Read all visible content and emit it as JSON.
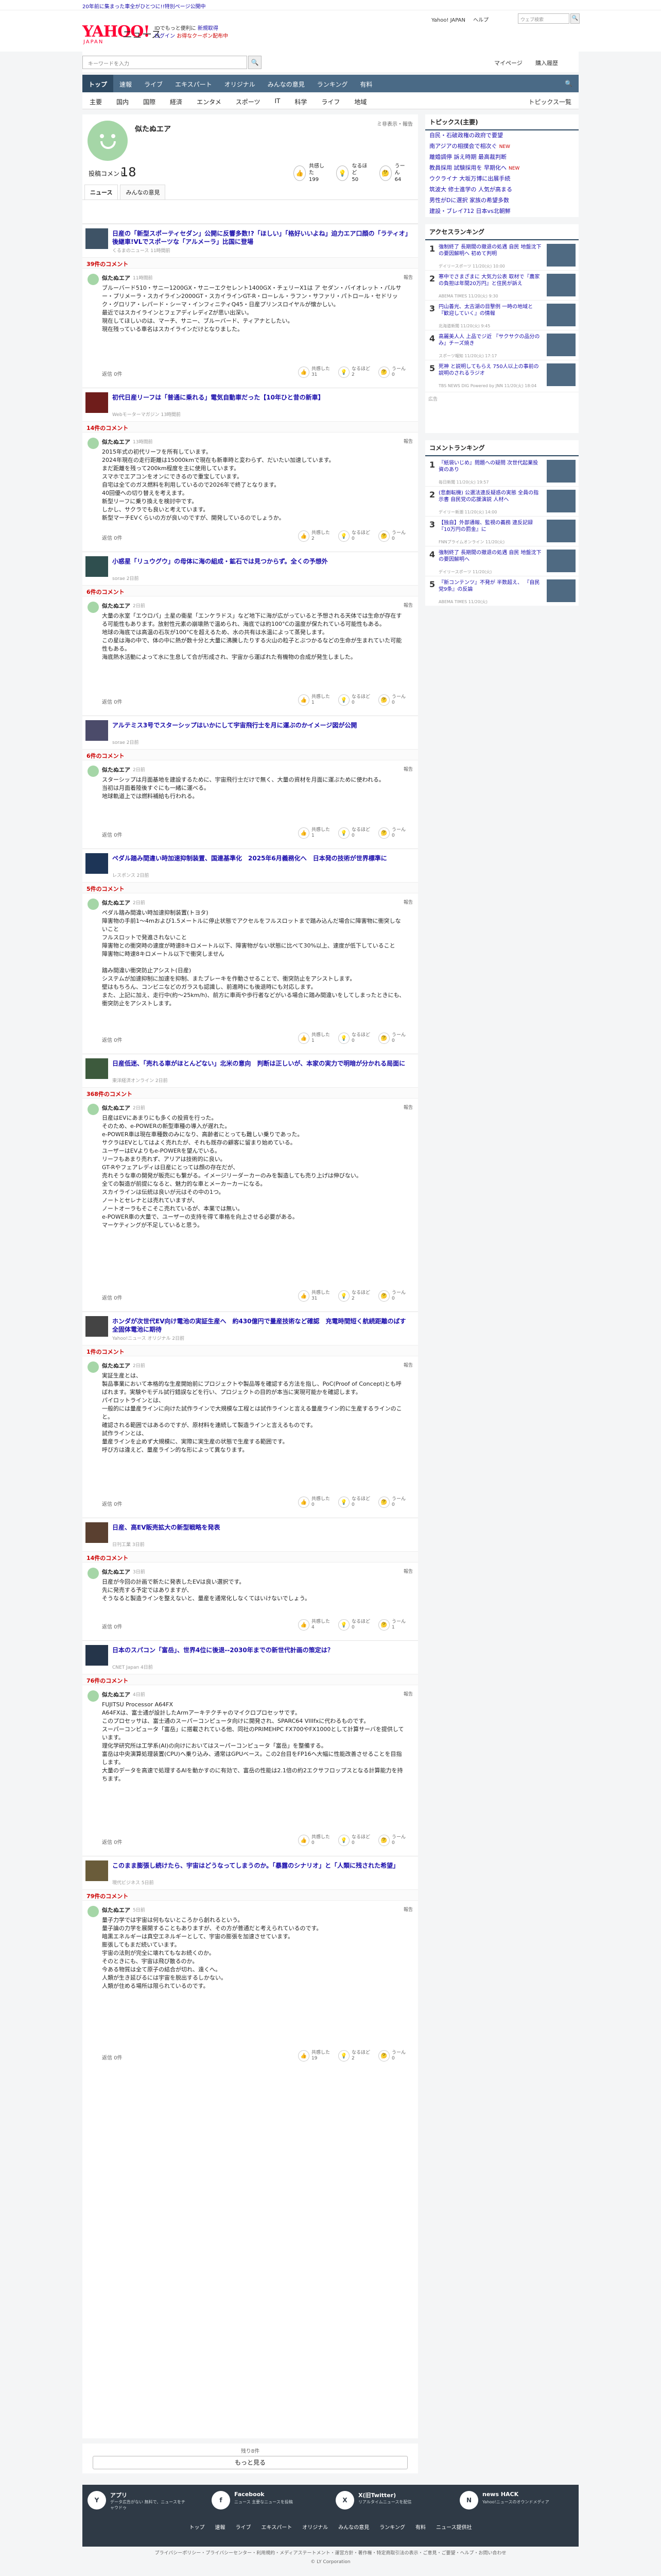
{
  "topnote": "20年前に集まった車全がひとつに!!特別ページ公開中",
  "header": {
    "logo": "YAHOO!",
    "logo_sub": "JAPAN",
    "service": "ニュース",
    "promo_line1": "IDでもっと便利に",
    "promo_link": "新規取得",
    "promo_line2": "ログイン",
    "promo_red": "お得なクーポン配布中",
    "right_links": [
      "Yahoo! JAPAN",
      "ヘルプ"
    ],
    "search_placeholder": "ウェブ検索",
    "search_btn": "🔍"
  },
  "searchrow": {
    "placeholder": "キーワードを入力",
    "mypage": "マイページ",
    "purchase": "購入履歴"
  },
  "gnav": {
    "items": [
      "トップ",
      "速報",
      "ライブ",
      "エキスパート",
      "オリジナル",
      "みんなの意見",
      "ランキング",
      "有料"
    ],
    "active": 0,
    "right": "🔍"
  },
  "subnav": {
    "items": [
      "主要",
      "国内",
      "国際",
      "経済",
      "エンタメ",
      "スポーツ",
      "IT",
      "科学",
      "ライフ",
      "地域"
    ],
    "right": "トピックス一覧"
  },
  "profile": {
    "name": "似たぬエア",
    "flag": "ミ非表示・報告",
    "comments_label": "投稿コメント",
    "comments": "18",
    "stats": [
      {
        "icon": "👍",
        "label": "共感した",
        "value": "199"
      },
      {
        "icon": "💡",
        "label": "なるほど",
        "value": "50"
      },
      {
        "icon": "🤔",
        "label": "うーん",
        "value": "64"
      }
    ],
    "tabs": [
      "ニュース",
      "みんなの意見"
    ]
  },
  "articles": [
    {
      "title": "日産の「新型スポーティセダン」公開に反響多数!?「ほしい」「格好いいよね」迫力エア口顔の「ラティオ」後継車!VLでスポーツな「アルメーラ」比国に登場",
      "source": "くるまのニュース 11時間前",
      "count": "39件のコメント",
      "time": "11時間前",
      "body": "ブルーバード510・サニー1200GX・サニーエクセレント1400GX・チェリーX1は ア セダン・バイオレット・パルサー・プリメーラ・スカイライン2000GT・スカイラインGT-R・ローレル・ラフン・サファリ・パトロール・セドリック・グロリア・レパード・シーマ・インフィニティQ45・日産プリンスロイヤルが懐かしい。\n最近ではスカイラインとフェアディレディZが思い出深い。\n現在してほしいのは、マーチ、サニー、ブルーバード、ティアナとしたい。\n現在残っている車名はスカイラインだけとなりました。",
      "reactions": [
        "31",
        "2",
        "0"
      ]
    },
    {
      "title": "初代日産リーフは「普通に乗れる」電気自動車だった【10年ひと昔の新車】",
      "source": "Webモーターマガジン 13時間前",
      "count": "14件のコメント",
      "time": "13時間前",
      "body": "2015年式の初代リーフを所有しています。\n2024年現在の走行距離は15000kmで現在も新車時と変わらず、だいたい加速しています。\nまだ距離を残って200km程度を主に使用しています。\nスマホでエアコンをオンにできるので重宝しています。\n自宅は全てのガス燃料を利用しているので2026年で終了となります。\n40回優への切り替えを考えます。\n新型リーフに乗り換えを検討中です。\nしかし、サクラでも良いと考えています。\n新型マーチEVくらいの方が良いのですが、開発しているのでしょうか。",
      "reactions": [
        "2",
        "0",
        "0"
      ]
    },
    {
      "title": "小惑星「リュウグウ」の母体に海の組成・鉱石では見つからず。全くの予想外",
      "source": "sorae 2日前",
      "count": "6件のコメント",
      "time": "2日前",
      "body": "大量の氷室「エウロパ」土星の衛星「エンケラドス」など地下に海が広がっていると予想される天体では生命が存在する可能性もあります。放射性元素の崩壊熱で温められ、海底では約100°Cの温度が保たれている可能性もある。\n地球の海底では高温の石灰が100°Cを超えるため、水の共有は水温によって蒸発します。\nこの星は海の中で、体の中に熱が数十分と大量に沸騰したりする火山の粒子とぶつかるなどの生命が生まれていた可能性もある。\n海底熱水活動によって水に生息して合が形成され、宇宙から運ばれた有機物の合成が発生しました。",
      "reactions": [
        "1",
        "0",
        "0"
      ]
    },
    {
      "title": "アルテミス3号でスターシップはいかにして宇宙飛行士を月に運ぶのかイメージ図が公開",
      "source": "sorae 2日前",
      "count": "6件のコメント",
      "time": "2日前",
      "body": "スターシップは月面基地を建設するために、宇宙飛行士だけで無く、大量の資材を月面に運ぶために使われる。\n当初は月面着陸後すぐにも一緒に運べる。\n地球軌道上では燃料補給も行われる。",
      "reactions": [
        "1",
        "0",
        "0"
      ]
    },
    {
      "title": "ペダル踏み間違い時加速抑制装置、国連基準化　2025年6月義務化へ　日本発の技術が世界標準に",
      "source": "レスポンス 2日前",
      "count": "5件のコメント",
      "time": "2日前",
      "body": "ペダル踏み間違い時加速抑制装置(トヨタ)\n障害物の手前1～4mおよび1.5メートルに停止状態でアクセルをフルスロットまで踏み込んだ場合に障害物に衝突しないこと\nフルスロットで発進されないこと\n障害物との衝突時の速度が時速8キロメートル以下、障害物がない状態に比べて30%以上、速度が低下していること\n障害物に時速8キロメートル以下で衝突しません\n\n踏み間違い衝突防止アシスト(日産)\nシステムが加速抑制に加速を抑制、またブレーキを作動させることで、衝突防止をアシストします。\n壁はもちろん、コンビニなどのガラスも認識し、前進時にも後退時にも対応します。\nまた、上記に加え、走行中(約～25km/h)、前方に車両や歩行者などがいる場合に踏み間違いをしてしまったときにも、衝突防止をアシストします。",
      "reactions": [
        "1",
        "0",
        "0"
      ]
    },
    {
      "title": "日産低迷、「売れる車がほとんどない」北米の意向　判断は正しいが、本家の実力で明暗が分かれる局面に",
      "source": "東洋経済オンライン 2日前",
      "count": "368件のコメント",
      "time": "2日前",
      "body": "日産はEVにあまりにも多くの投資を行った。\nそのため、e-POWERの新型車種の導入が遅れた。\ne-POWER車は現在車種数のみになり、高齢者にとっても難しい乗りであった。\nサクラはEVとしてはよく売れたが、それも既存の顧客に留まり始めている。\nユーザーはEVよりもe-POWERを望んでいる。\nリーフもあまり売れず、アリアは技術的に良い。\nGT-Rやフェアレディは日産にとっては顔の存在だが、\n売れそうな車の開発が販売にも繋がる。イメージリーダーカーのみを製造しても売り上げは伸びない。\n全ての製造が前提になると、魅力的な車とメーカーカーになる。\nスカイラインは伝統は良いが元はその中の1つ。\nノートとセレナとは売れていますが、\nノートオーラもそこそこ売れているが、本業では無い。\ne-POWER車の大量で、ユーザーの支持を得て車格を向上させる必要がある。\nマーケティングが不足していると思う。",
      "reactions": [
        "31",
        "2",
        "0"
      ]
    },
    {
      "title": "ホンダが次世代EV向け電池の実証生産へ　約430億円で量産技術など確認　充電時間短く航続距離のばす全固体電池に期待",
      "source": "Yahoo!ニュース オリジナル 2日前",
      "count": "1件のコメント",
      "time": "2日前",
      "body": "実証生産とは、\n製品事業において本格的な生産開始前にプロジェクトや製品等を確認する方法を指し、PoC(Proof of Concept)とも呼ばれます。実験やモデル試行錯誤などを行い、プロジェクトの目的が本当に実現可能かを確認します。\nパイロットラインとは、\n一般的には量産ラインに向けた試作ラインで大規模な工程とは試作ラインと言える量産ライン的に生産するラインのこと。\n確認される範囲ではあるのですが、原材料を連続して製造ラインと言えるものです。\n試作ラインとは、\n量産ラインを止めず大規模に、実際に実生産の状態で生産する範囲です。\n呼び方は違えど、量産ライン的な形によって異なります。",
      "reactions": [
        "0",
        "0",
        "0"
      ]
    },
    {
      "title": "日産、高EV販売拡大の新型戦略を発表",
      "source": "日刊工業 3日前",
      "count": "14件のコメント",
      "time": "3日前",
      "body": "日産が今回の計画で新たに発表したEVは良い選択です。\n先に発売する予定ではありますが、\nそうなると製造ラインを整えないと、量産を通常化しなくてはいけないでしょう。",
      "reactions": [
        "4",
        "0",
        "1"
      ]
    },
    {
      "title": "日本のスパコン「富岳」、世界4位に後退--2030年までの新世代計画の策定は？",
      "source": "CNET Japan 4日前",
      "count": "76件のコメント",
      "time": "4日前",
      "body": "FUJITSU Processor A64FX\nA64FXは、富士通が設計したArmアーキテクチャのマイクロプロセッサです。\nこのプロセッサは、富士通のスーパーコンピュータ向けに開発され、SPARC64 VIIIfxに代わるものです。\nスーパーコンピュータ「富岳」に搭載されている他、同社のPRIMEHPC FX700やFX1000として計算サーバを提供しています。\n理化学研究所は工学系(AI)の向けにおいてはスーパーコンピュータ「富岳」を整備する。\n富岳は中央演算処理装置(CPU)へ乗り込み、通常はGPUベース。この2台目をFP16へ大幅に性能改善させることを目指します。\n大量のデータを高速で処理するAIを動かすのに有効で、富岳の性能は2.1倍の約2エクサフロップスとなる計算能力を持ちます。",
      "reactions": [
        "0",
        "0",
        "0"
      ]
    },
    {
      "title": "このまま膨張し続けたら、宇宙はどうなってしまうのか。「暴露のシナリオ」と「人類に残された希望」",
      "source": "現代ビジネス 5日前",
      "count": "79件のコメント",
      "time": "5日前",
      "body": "量子力学では宇宙は何もないところから創れるという。\n量子論の力学を展開することもありますが、その方が普通だと考えられているのです。\n暗黒エネルギーは真空エネルギーとして、宇宙の膨張を加速させています。\n膨張してもまだ続いています。\n宇宙の法則が完全に壊れてもなお続くのか。\nそのときにも、宇宙は飛び散るのか。\n今ある物質は全て原子の結合が切れ、遠くへ。\n人類が生き延びるには宇宙を脱出するしかない。\n人類が住める場所は限られているのです。",
      "reactions": [
        "19",
        "2",
        "0"
      ]
    }
  ],
  "common": {
    "reply": "返信 0件",
    "report": "報告",
    "react_labels": [
      "共感した",
      "なるほど",
      "うーん"
    ]
  },
  "more": {
    "count": "残り8件",
    "button": "もっと見る"
  },
  "sidebar": {
    "topics_title": "トピックス(主要)",
    "topics": [
      {
        "text": "自民・石破政権の政府で要望",
        "new": ""
      },
      {
        "text": "南アジアの相撲会で相次ぐ",
        "new": "NEW"
      },
      {
        "text": "離婚調停 訴え時期 最高裁判断",
        "new": ""
      },
      {
        "text": "教員採用 試験採用を 早期化へ",
        "new": "NEW"
      },
      {
        "text": "ウクライナ 大坂万博に出展手続",
        "new": ""
      },
      {
        "text": "筑波大 修士進学の 人気が高まる",
        "new": ""
      },
      {
        "text": "男性がDに選択 家族の希望多数",
        "new": ""
      },
      {
        "text": "建設・ブレイ712 日本vs北朝鮮",
        "new": ""
      }
    ],
    "access_title": "アクセスランキング",
    "access": [
      {
        "t": "強制終了 長期間の撤退の処遇 自民 地盤沈下の要因解明へ 初めて判明",
        "s": "デイリースポーツ 11/20(火) 10:00"
      },
      {
        "t": "寒中でさまざまに 大気力公表 取材で『農家の負担は年間20万円』と住民が訴え",
        "s": "ABEMA TIMES 11/20(火) 9:30"
      },
      {
        "t": "円山善光、太古湖の目撃例 一時の地域と『歓迎していく』の情報",
        "s": "北海道新聞 11/20(火) 9:45"
      },
      {
        "t": "高麗美人人 上品でジ近 『サクサクの品分のみ』チーズ焼き",
        "s": "スポーツ報知 11/20(火) 17:17"
      },
      {
        "t": "死神 と説明してもらえ 750人以上の事前の説明のされるラジオ",
        "s": "TBS NEWS DIG Powered by JNN 11/20(火) 18:04"
      }
    ],
    "comment_title": "コメントランキング",
    "comments": [
      {
        "t": "『紙袋いじめ』問題への疑問 次世代起業投資のあり",
        "s": "毎日新聞 11/20(火) 19:57"
      },
      {
        "t": "(悲劇転機) 公選法違反疑惑の実態 全員の指示書 自民党の応援演説 人材へ",
        "s": "デイリー新潮 11/20(火) 14:00"
      },
      {
        "t": "【独自】外部通報、監視の義務 違反記録『10万円の罰金』に",
        "s": "FNNプライムオンライン 11/20(火)"
      },
      {
        "t": "強制終了 長期間の撤退の処遇 自民 地盤沈下の要因解明へ",
        "s": "デイリースポーツ 11/20(火)"
      },
      {
        "t": "『新コンテンツ』不発が 半数超え、 『自民党9条』の反論",
        "s": "ABEMA TIMES 11/20(火)"
      }
    ],
    "ad": "広告"
  },
  "footer": {
    "apps": [
      {
        "icon": "Y",
        "title": "アプリ",
        "desc": "データ広告がない 無料で、ニュースをチャウドゥ"
      },
      {
        "icon": "f",
        "title": "Facebook",
        "desc": "ニュース 主要なニュースを投稿"
      },
      {
        "icon": "X",
        "title": "X(旧Twitter)",
        "desc": "リアルタイムニュースを配信"
      },
      {
        "icon": "N",
        "title": "news HACK",
        "desc": "Yahoo!ニュースのオウンドメディア"
      }
    ],
    "nav": [
      "トップ",
      "速報",
      "ライブ",
      "エキスパート",
      "オリジナル",
      "みんなの意見",
      "ランキング",
      "有料",
      "ニュース提供社"
    ],
    "links": "プライバシーポリシー・プライバシーセンター・利用規約・メディアステートメント・運営方針・著作権・特定商取引法の表示・ご意見・ご要望・ヘルプ・お問い合わせ",
    "copy": "© LY Corporation"
  }
}
